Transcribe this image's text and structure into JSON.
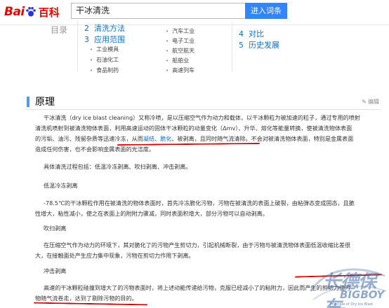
{
  "header": {
    "logo_bai": "Bai",
    "logo_du": "du",
    "logo_baike": "百科",
    "search_value": "干冰清洗",
    "search_button": "进入词条"
  },
  "toc": {
    "title_fragment": "目录",
    "items": [
      {
        "num": "2",
        "label": "清洗方法"
      },
      {
        "num": "3",
        "label": "应用范围"
      },
      {
        "num": "4",
        "label": "对比"
      },
      {
        "num": "5",
        "label": "历史发展"
      }
    ],
    "subs_left": [
      "工业模具",
      "石油化工",
      "食品制药"
    ],
    "subs_right": [
      "汽车工业",
      "电子工业",
      "航空航天",
      "船舶业",
      "高速列车"
    ]
  },
  "section": {
    "title": "原理",
    "edit": "编辑"
  },
  "content": {
    "p1_l1": "干冰清洗（dry ice blast cleaning）又称冷喷，是以压缩空气作为动力和载体，以干冰颗粒为被加速的粒子，通过专用的喷射",
    "p1_l2": "清洗机喷射到被清洗物体表面，利用高速运动的固体干冰颗粒的动量变化（Δmv）、升华、熔化等能量转换，使被清洗物体表面",
    "p1_l3a": "的污垢、油污、残留杂质等迅速冷冻，从而",
    "p1_l3_link1": "凝结",
    "p1_l3b": "、",
    "p1_l3_link2": "脆化",
    "p1_l3c": "、被剥离，且同时随气流清除。不会对被清洗物体表面，特别是金属表面",
    "p1_l4": "造成任何伤害，也不会影响金属表面的光洁度。",
    "p2": "具体清洗过程包括：低温冷冻剥离、吹扫剥离、冲击剥离。",
    "h_cold": "低温冷冻剥离",
    "p3_l1": "-78.5℃的干冰颗粒作用在被清洗的物体表面时，首先冷冻脆化污物，污物在被清洗的表面上破裂，由粘弹态变成固态，且脆",
    "p3_l2": "性增大，粘性减小，使之在表面上的附附力骤减，同时表面积增大，部分污物可以自动剥离。",
    "h_blow": "吹扫剥离",
    "p4_l1": "在压缩空气作为动力的环境下，其对脆化了的污物产生剪切力，引起机械断裂，由于污物与被清洗物体表面低温收缩比差很",
    "p4_l2": "大，在接触面处产生应力集中现象，污物在剪切力作用下剥离。",
    "h_impact": "冲击剥离",
    "p5_l1": "高速的干冰颗粒碰撞到增大了的污物表面时，将上述动能传递给污物，克服已经减小了的粘附力，因此而产生的剪切力使污",
    "p5_l2": "物随气流卷走，达到了剔除污物的目的。"
  },
  "watermark": {
    "big": "长德保车",
    "en": "BIGBOY",
    "small": "Principle of Dry Ice Blast Cleaning"
  },
  "colors": {
    "link": "#136ec2",
    "accent_blue": "#3385ff",
    "annotation_red": "#d10000"
  }
}
